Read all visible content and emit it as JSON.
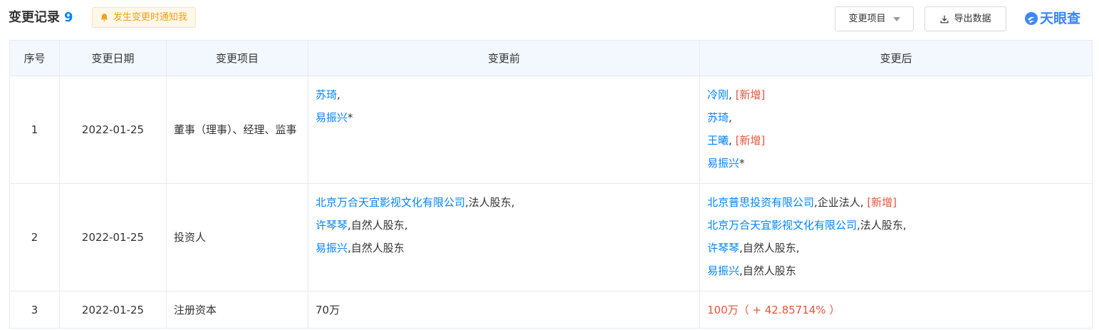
{
  "header": {
    "title": "变更记录",
    "count": "9",
    "notify_label": "发生变更时通知我",
    "filter_label": "变更项目",
    "export_label": "导出数据",
    "logo_text": "天眼查"
  },
  "table": {
    "columns": [
      "序号",
      "变更日期",
      "变更项目",
      "变更前",
      "变更后"
    ],
    "rows": [
      {
        "index": "1",
        "date": "2022-01-25",
        "item": "董事（理事）、经理、监事",
        "before": [
          {
            "name": "苏琦",
            "suffix": ",",
            "tag": ""
          },
          {
            "name": "易振兴",
            "suffix": "*",
            "tag": ""
          }
        ],
        "after": [
          {
            "name": "冷刚",
            "suffix": ", ",
            "tag": "[新增]"
          },
          {
            "name": "苏琦",
            "suffix": ",",
            "tag": ""
          },
          {
            "name": "王曦",
            "suffix": ", ",
            "tag": "[新增]"
          },
          {
            "name": "易振兴",
            "suffix": "*",
            "tag": ""
          }
        ]
      },
      {
        "index": "2",
        "date": "2022-01-25",
        "item": "投资人",
        "before": [
          {
            "name": "北京万合天宜影视文化有限公司",
            "suffix": ",法人股东,",
            "tag": ""
          },
          {
            "name": "许琴琴",
            "suffix": ",自然人股东,",
            "tag": ""
          },
          {
            "name": "易振兴",
            "suffix": ",自然人股东",
            "tag": ""
          }
        ],
        "after": [
          {
            "name": "北京普思投资有限公司",
            "suffix": ",企业法人, ",
            "tag": "[新增]"
          },
          {
            "name": "北京万合天宜影视文化有限公司",
            "suffix": ",法人股东,",
            "tag": ""
          },
          {
            "name": "许琴琴",
            "suffix": ",自然人股东,",
            "tag": ""
          },
          {
            "name": "易振兴",
            "suffix": ",自然人股东",
            "tag": ""
          }
        ]
      },
      {
        "index": "3",
        "date": "2022-01-25",
        "item": "注册资本",
        "before_text": "70万",
        "after_text": "100万（ + 42.85714% ）"
      }
    ]
  }
}
